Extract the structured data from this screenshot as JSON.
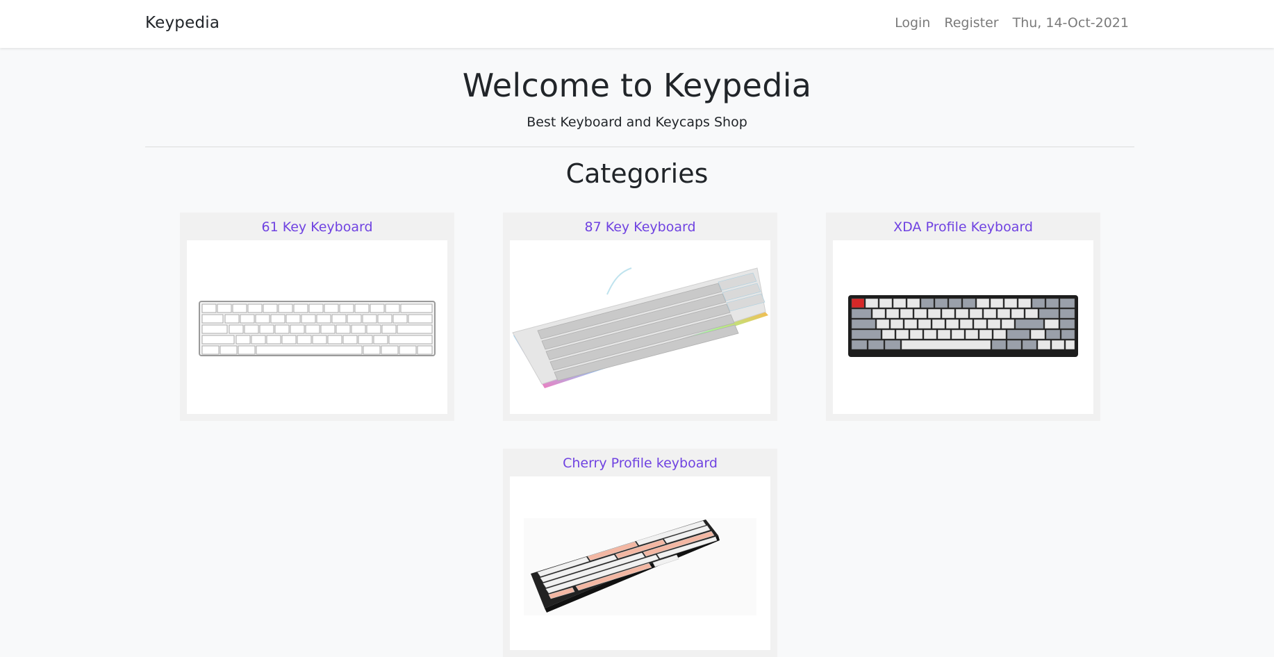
{
  "navbar": {
    "brand": "Keypedia",
    "links": {
      "login": "Login",
      "register": "Register",
      "date": "Thu, 14-Oct-2021"
    }
  },
  "hero": {
    "title": "Welcome to Keypedia",
    "subtitle": "Best Keyboard and Keycaps Shop"
  },
  "categories": {
    "heading": "Categories",
    "items": [
      {
        "label": "61 Key Keyboard",
        "image": "61-key-keyboard-image"
      },
      {
        "label": "87 Key Keyboard",
        "image": "87-key-keyboard-image"
      },
      {
        "label": "XDA Profile Keyboard",
        "image": "xda-profile-keyboard-image"
      },
      {
        "label": "Cherry Profile keyboard",
        "image": "cherry-profile-keyboard-image"
      }
    ]
  },
  "colors": {
    "link": "#6f42e1",
    "page_bg": "#f8f9fa",
    "card_bg": "#f1f1f1"
  }
}
